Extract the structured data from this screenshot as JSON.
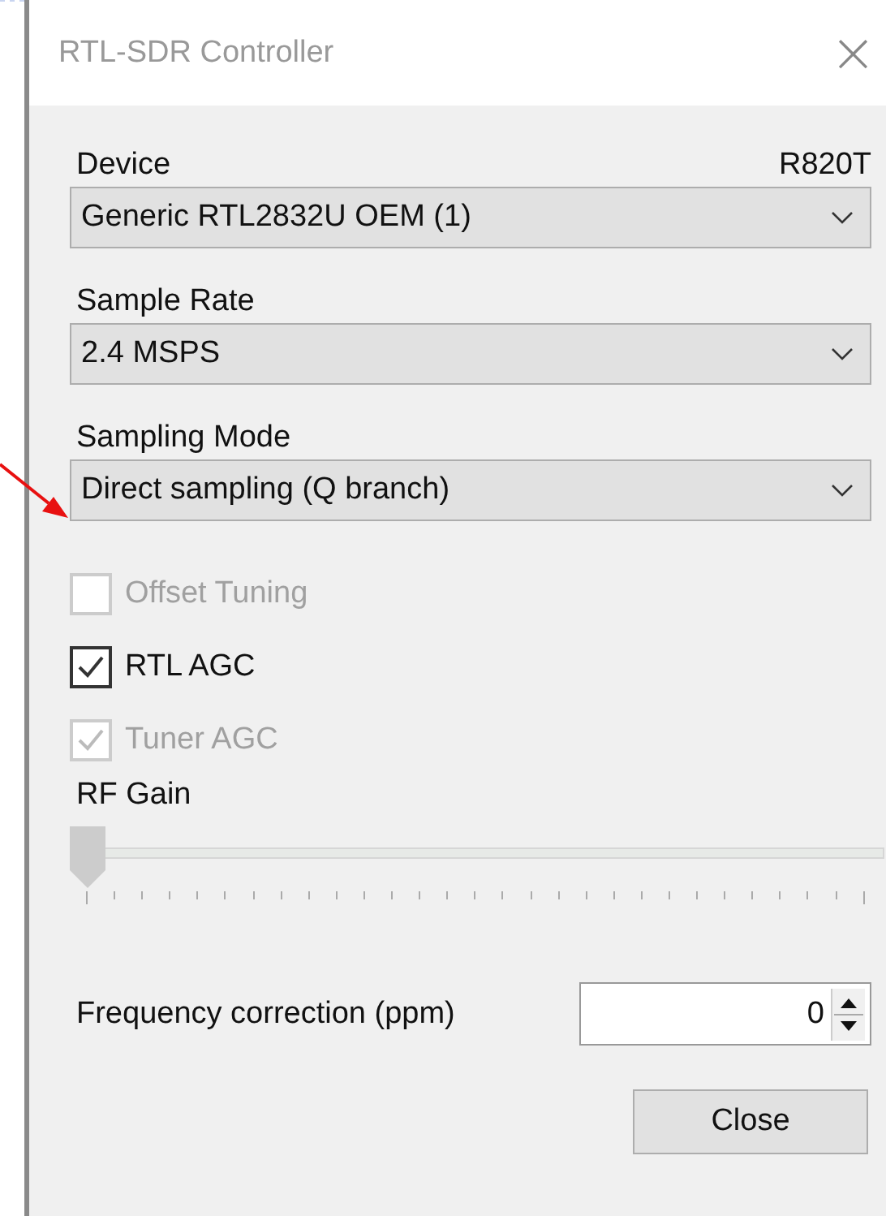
{
  "window": {
    "title": "RTL-SDR Controller",
    "close": "×"
  },
  "device": {
    "label": "Device",
    "tuner": "R820T",
    "value": "Generic RTL2832U OEM (1)"
  },
  "sample_rate": {
    "label": "Sample Rate",
    "value": "2.4 MSPS"
  },
  "sampling_mode": {
    "label": "Sampling Mode",
    "value": "Direct sampling (Q branch)"
  },
  "options": [
    {
      "label": "Offset Tuning",
      "checked": false,
      "disabled": true
    },
    {
      "label": "RTL AGC",
      "checked": true,
      "disabled": false
    },
    {
      "label": "Tuner AGC",
      "checked": true,
      "disabled": true
    }
  ],
  "rf_gain": {
    "label": "RF Gain",
    "level": 0,
    "disabled": true
  },
  "frequency_correction": {
    "label": "Frequency correction (ppm)",
    "value": "0"
  },
  "buttons": [
    "Close"
  ]
}
